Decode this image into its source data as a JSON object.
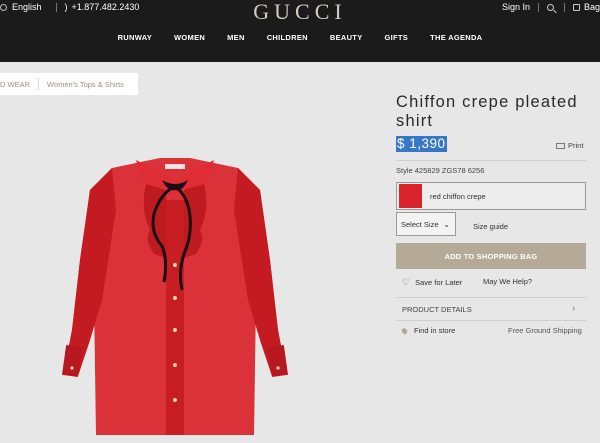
{
  "header": {
    "language": "English",
    "phone": "+1.877.482.2430",
    "logo": "GUCCI",
    "sign_in": "Sign In",
    "bag": "Bag",
    "nav": [
      "RUNWAY",
      "WOMEN",
      "MEN",
      "CHILDREN",
      "BEAUTY",
      "GIFTS",
      "THE AGENDA"
    ]
  },
  "breadcrumb": {
    "items": [
      "D WEAR",
      "Women's Tops & Shirts"
    ]
  },
  "product": {
    "title": "Chiffon crepe pleated shirt",
    "price": "$ 1,390",
    "print_label": "Print",
    "style": "Style 425829 ZGS78 6256",
    "color_label": "red chiffon crepe",
    "size_select": "Select Size",
    "size_guide": "Size guide",
    "add_to_bag": "ADD TO SHOPPING BAG",
    "save_for_later": "Save for Later",
    "may_we_help": "May We Help?",
    "product_details": "PRODUCT DETAILS",
    "find_in_store": "Find in store",
    "shipping": "Free Ground Shipping"
  },
  "icons": {
    "globe": "globe-icon",
    "phone": "phone-icon",
    "search": "search-icon",
    "bag": "bag-icon",
    "print": "print-icon",
    "heart": "heart-icon",
    "chevron": "chevron-right-icon",
    "pin": "map-pin-icon"
  },
  "colors": {
    "header_bg": "#1b1b1b",
    "logo": "#d3cdbf",
    "accent_button": "#b5aa97",
    "price_highlight": "#3877c8",
    "shirt_red": "#d8232a"
  }
}
